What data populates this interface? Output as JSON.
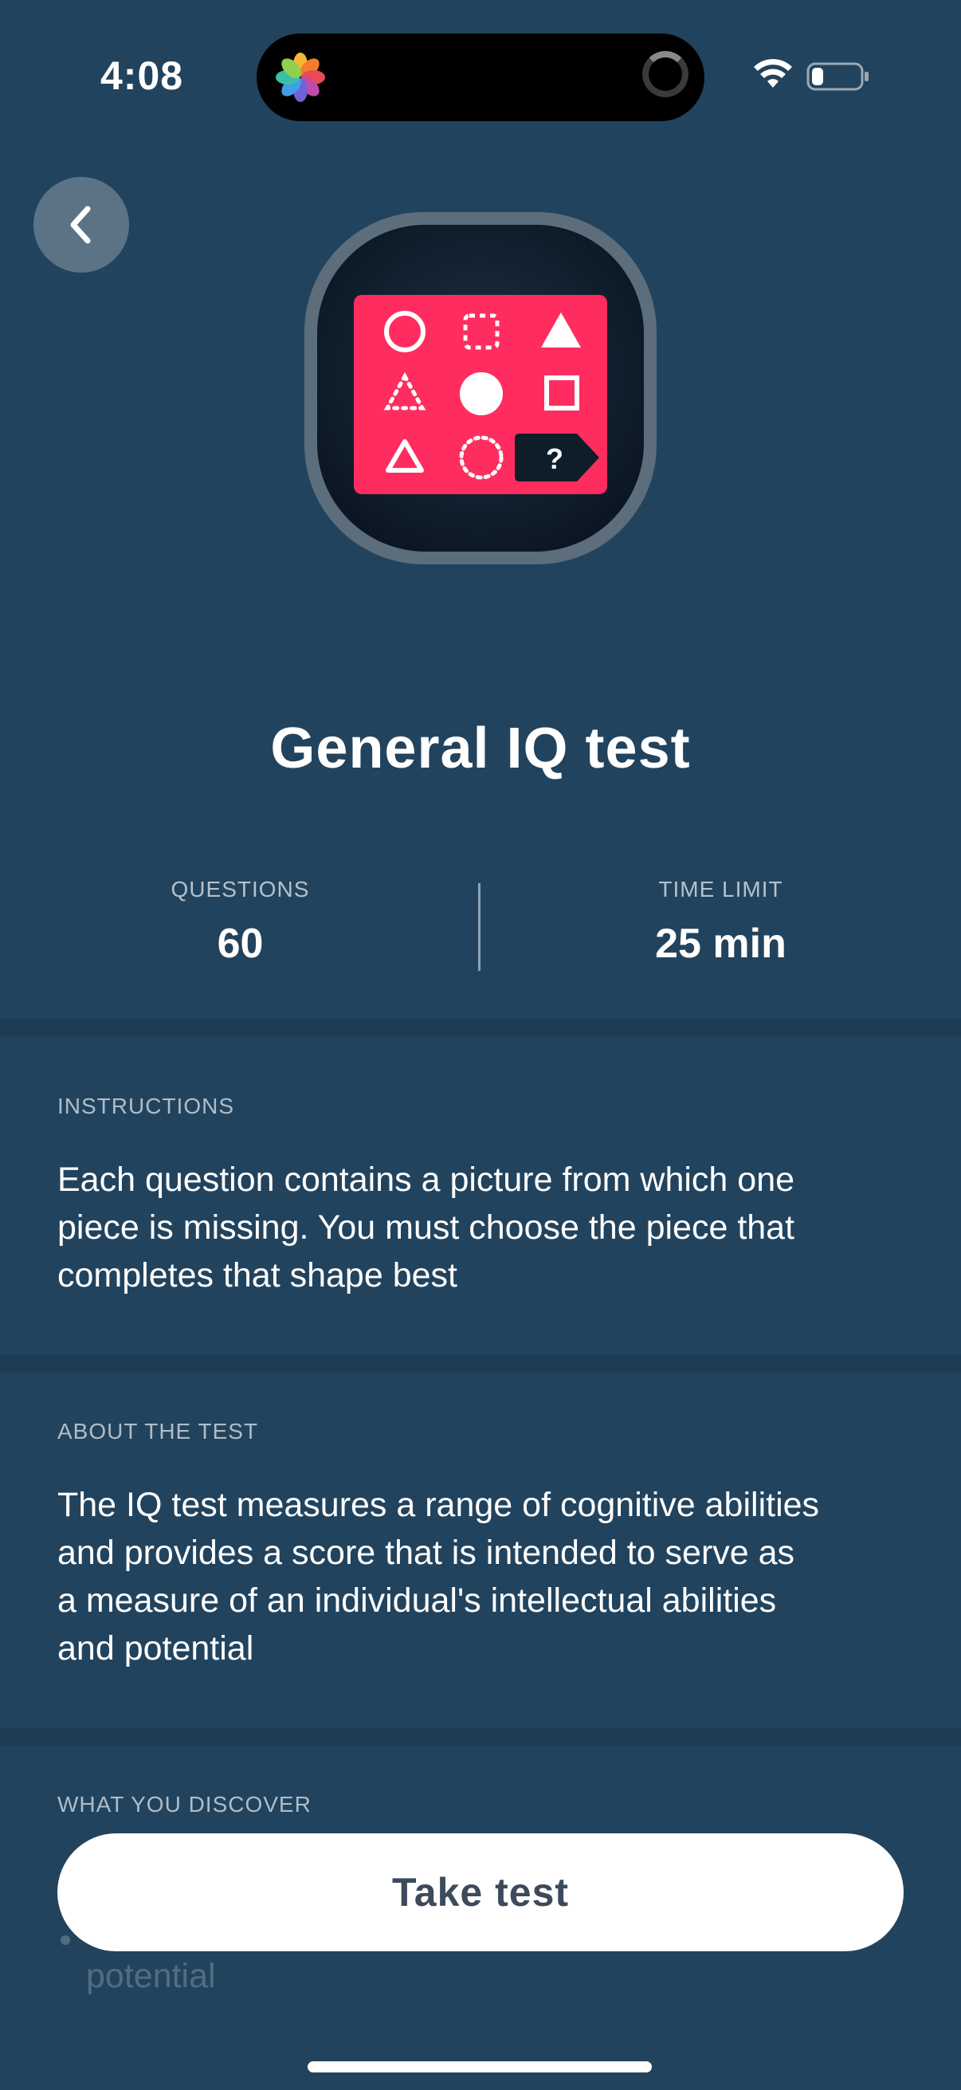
{
  "status_bar": {
    "time": "4:08"
  },
  "icons": {
    "back": "chevron-left-icon",
    "wifi": "wifi-icon",
    "battery": "battery-icon",
    "photos": "photos-icon",
    "hero": "shape-puzzle-icon"
  },
  "hero": {
    "question_mark": "?"
  },
  "title": "General IQ test",
  "stats": {
    "questions_label": "QUESTIONS",
    "questions_value": "60",
    "time_label": "TIME LIMIT",
    "time_value": "25 min"
  },
  "instructions": {
    "heading": "INSTRUCTIONS",
    "lines": [
      "Each question contains a picture from which one",
      "piece is missing. You must choose the piece that",
      "completes that shape best"
    ]
  },
  "about": {
    "heading": "ABOUT THE TEST",
    "lines": [
      "The IQ test measures a range of cognitive abilities",
      "and provides a score that is intended to serve as",
      "a measure of an individual's intellectual abilities",
      "and potential"
    ]
  },
  "discover": {
    "heading": "WHAT YOU DISCOVER",
    "peek_text": "potential"
  },
  "cta": {
    "label": "Take test"
  },
  "colors": {
    "background": "#22435d",
    "separator": "#1e3c54",
    "card_pink": "#ff2d5f",
    "button_bg": "#ffffff",
    "button_text": "#3d4a5c"
  }
}
